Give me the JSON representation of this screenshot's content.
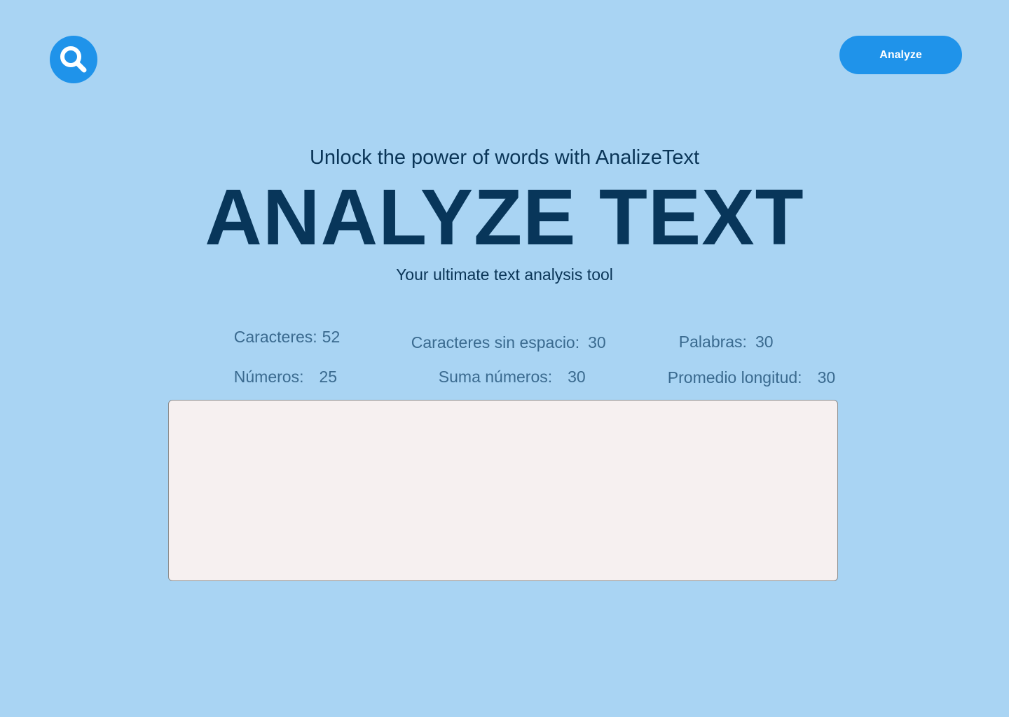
{
  "header": {
    "logo_icon": "search-icon",
    "analyze_button_label": "Analyze"
  },
  "hero": {
    "tagline": "Unlock the power of words with AnalizeText",
    "title": "ANALYZE TEXT",
    "subtitle": "Your ultimate text analysis tool"
  },
  "stats": {
    "caracteres": {
      "label": "Caracteres:",
      "value": "52"
    },
    "caracteres_sin_espacio": {
      "label": "Caracteres sin espacio:",
      "value": "30"
    },
    "palabras": {
      "label": "Palabras:",
      "value": "30"
    },
    "numeros": {
      "label": "Números:",
      "value": "25"
    },
    "suma_numeros": {
      "label": "Suma números:",
      "value": "30"
    },
    "promedio_longitud": {
      "label": "Promedio longitud:",
      "value": "30"
    }
  },
  "input": {
    "text": "",
    "placeholder": ""
  },
  "colors": {
    "background": "#a9d4f3",
    "accent": "#1f93ea",
    "title": "#08365a",
    "stat_text": "#3a6a8f",
    "textarea_bg": "#f6f0f0"
  }
}
